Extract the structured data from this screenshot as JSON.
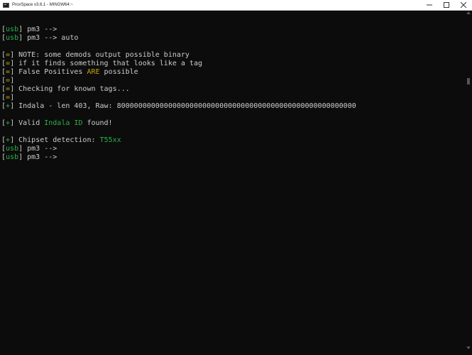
{
  "window": {
    "title": "ProxSpace v3.6.1 - MINGW64:~",
    "controls": {
      "minimize": "—",
      "maximize": "☐",
      "close": "✕"
    }
  },
  "colors": {
    "background": "#0c0c0c",
    "text": "#c8c8c8",
    "green": "#2bb14a",
    "yellow": "#c7a20a"
  },
  "terminal": {
    "lines": [
      {
        "bracket": "",
        "tag": "",
        "parts": []
      },
      {
        "bracket": "[",
        "tag": "usb",
        "tag_color": "green",
        "close": "]",
        "parts": [
          {
            "text": " pm3 -->",
            "color": "w"
          }
        ]
      },
      {
        "bracket": "[",
        "tag": "usb",
        "tag_color": "green",
        "close": "]",
        "parts": [
          {
            "text": " pm3 --> auto",
            "color": "w"
          }
        ]
      },
      {
        "bracket": "",
        "tag": "",
        "parts": []
      },
      {
        "bracket": "[",
        "tag": "=",
        "tag_color": "yellow",
        "close": "]",
        "parts": [
          {
            "text": " NOTE: some demods output possible binary",
            "color": "w"
          }
        ]
      },
      {
        "bracket": "[",
        "tag": "=",
        "tag_color": "yellow",
        "close": "]",
        "parts": [
          {
            "text": " if it finds something that looks like a tag",
            "color": "w"
          }
        ]
      },
      {
        "bracket": "[",
        "tag": "=",
        "tag_color": "yellow",
        "close": "]",
        "parts": [
          {
            "text": " False Positives ",
            "color": "w"
          },
          {
            "text": "ARE",
            "color": "y"
          },
          {
            "text": " possible",
            "color": "w"
          }
        ]
      },
      {
        "bracket": "[",
        "tag": "=",
        "tag_color": "yellow",
        "close": "]",
        "parts": []
      },
      {
        "bracket": "[",
        "tag": "=",
        "tag_color": "yellow",
        "close": "]",
        "parts": [
          {
            "text": " Checking for known tags...",
            "color": "w"
          }
        ]
      },
      {
        "bracket": "[",
        "tag": "=",
        "tag_color": "yellow",
        "close": "]",
        "parts": []
      },
      {
        "bracket": "[",
        "tag": "+",
        "tag_color": "green",
        "close": "]",
        "parts": [
          {
            "text": " Indala - len 403, Raw: 80000000000000000000000000000000000000000000000000000000",
            "color": "w"
          }
        ]
      },
      {
        "bracket": "",
        "tag": "",
        "parts": []
      },
      {
        "bracket": "[",
        "tag": "+",
        "tag_color": "green",
        "close": "]",
        "parts": [
          {
            "text": " Valid ",
            "color": "w"
          },
          {
            "text": "Indala ID",
            "color": "g"
          },
          {
            "text": " found!",
            "color": "w"
          }
        ]
      },
      {
        "bracket": "",
        "tag": "",
        "parts": []
      },
      {
        "bracket": "[",
        "tag": "+",
        "tag_color": "green",
        "close": "]",
        "parts": [
          {
            "text": " Chipset detection: ",
            "color": "w"
          },
          {
            "text": "T55xx",
            "color": "g"
          }
        ]
      },
      {
        "bracket": "[",
        "tag": "usb",
        "tag_color": "green",
        "close": "]",
        "parts": [
          {
            "text": " pm3 -->",
            "color": "w"
          }
        ]
      },
      {
        "bracket": "[",
        "tag": "usb",
        "tag_color": "green",
        "close": "]",
        "parts": [
          {
            "text": " pm3 -->",
            "color": "w"
          }
        ]
      }
    ]
  }
}
